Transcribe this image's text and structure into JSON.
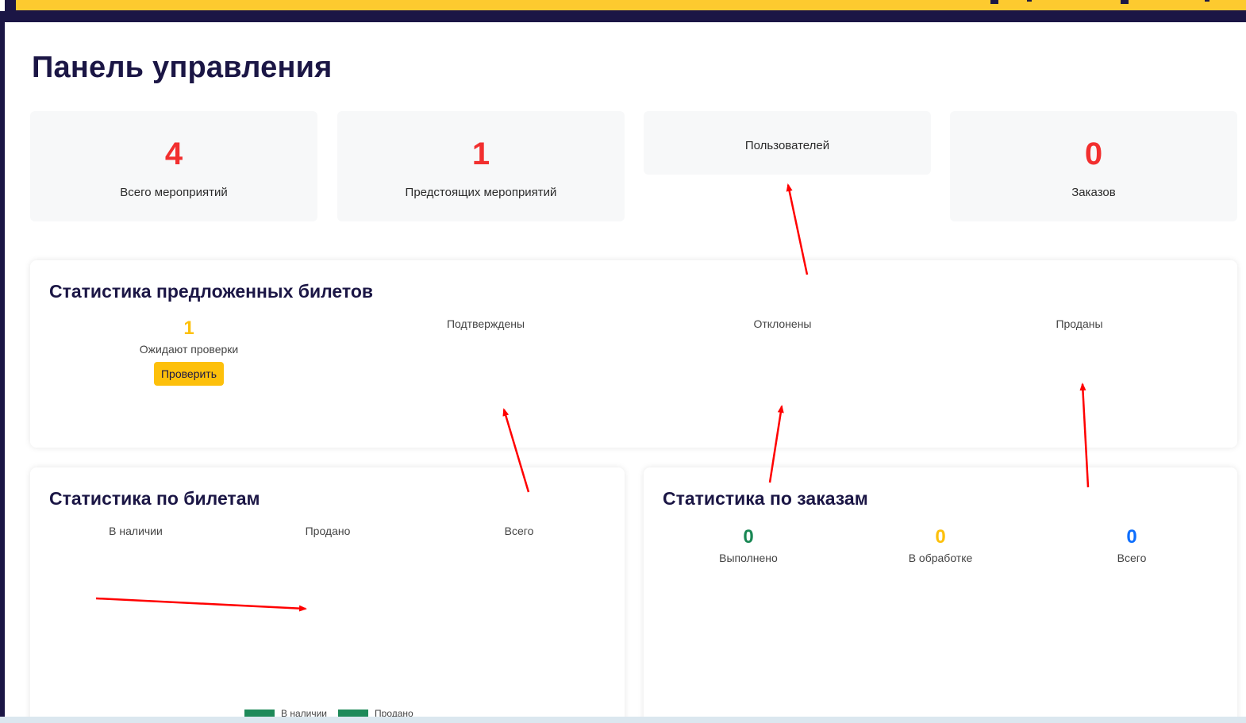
{
  "header": {
    "brand_color": "#fdca2f"
  },
  "page": {
    "title": "Панель управления"
  },
  "cards": [
    {
      "value": "4",
      "label": "Всего мероприятий"
    },
    {
      "value": "1",
      "label": "Предстоящих мероприятий"
    },
    {
      "value": "",
      "label": "Пользователей"
    },
    {
      "value": "0",
      "label": "Заказов"
    }
  ],
  "offered_tickets": {
    "title": "Статистика предложенных билетов",
    "pending": {
      "value": "1",
      "label": "Ожидают проверки",
      "button": "Проверить"
    },
    "confirmed": {
      "label": "Подтверждены"
    },
    "rejected": {
      "label": "Отклонены"
    },
    "sold": {
      "label": "Проданы"
    }
  },
  "ticket_stats": {
    "title": "Статистика по билетам",
    "columns": [
      "В наличии",
      "Продано",
      "Всего"
    ],
    "legend": [
      {
        "label": "В наличии",
        "color": "#1e8a59"
      },
      {
        "label": "Продано",
        "color": "#1e8a59"
      }
    ]
  },
  "order_stats": {
    "title": "Статистика по заказам",
    "columns": [
      {
        "value": "0",
        "label": "Выполнено",
        "color": "#198754"
      },
      {
        "value": "0",
        "label": "В обработке",
        "color": "#fdc00b"
      },
      {
        "value": "0",
        "label": "Всего",
        "color": "#0d6efd"
      }
    ]
  },
  "colors": {
    "accent_red": "#f22f2f",
    "annotation": "#ff0000",
    "navy": "#1b1645"
  }
}
